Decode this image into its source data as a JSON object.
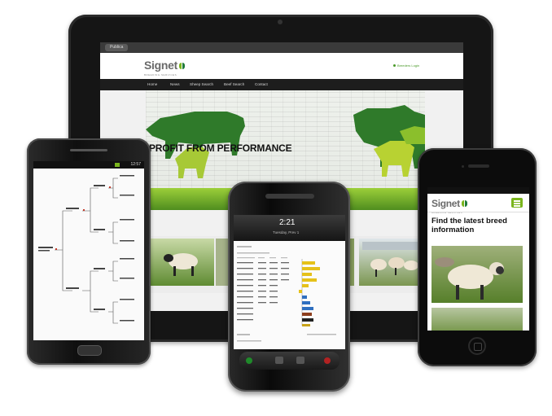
{
  "tablet": {
    "browser_tab": "Publica",
    "brand": "Signet",
    "brand_sub": "BREEDING SERVICES",
    "login_link": "Breeders Login",
    "nav": [
      "Home",
      "News",
      "Sheep Search",
      "Beef Search",
      "Contact"
    ],
    "hero_title": "PROFIT FROM PERFORMANCE"
  },
  "samsung": {
    "status_time": "12:57"
  },
  "blackberry": {
    "time": "2:21",
    "date": "Tuesday, Prev 1"
  },
  "iphone": {
    "brand": "Signet",
    "brand_sub": "BREEDING SERVICES",
    "heading": "Find the latest breed information"
  },
  "colors": {
    "brand_green": "#7ab51d",
    "brand_dark_green": "#1f7a3a",
    "nav_dark": "#1d1d1d",
    "bar_yellow": "#e5c11a",
    "bar_blue": "#2f6fc0"
  }
}
